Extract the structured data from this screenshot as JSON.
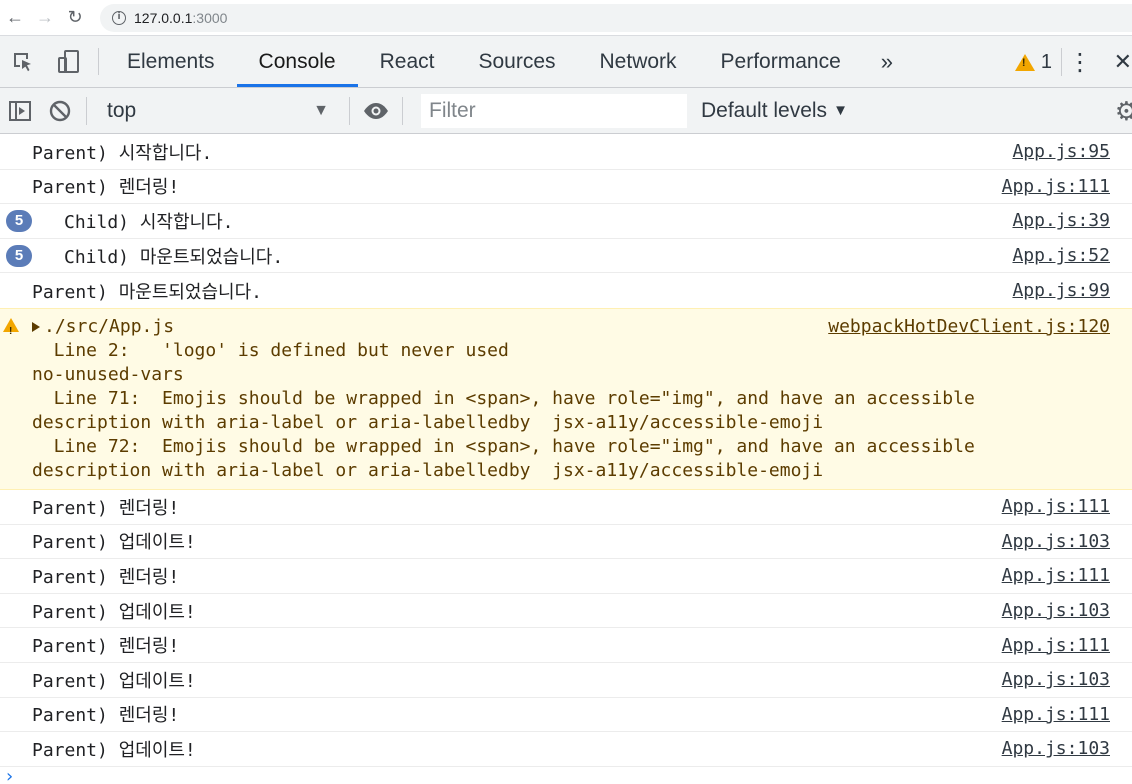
{
  "browser": {
    "url_host": "127.0.0.1",
    "url_port": ":3000"
  },
  "devtools": {
    "tabs": [
      "Elements",
      "Console",
      "React",
      "Sources",
      "Network",
      "Performance"
    ],
    "active_tab": "Console",
    "more_tabs_label": "»",
    "warning_count": "1"
  },
  "console_toolbar": {
    "context": "top",
    "filter_placeholder": "Filter",
    "levels_label": "Default levels"
  },
  "log_rows_top": [
    {
      "message": "Parent) 시작합니다.",
      "source": "App.js:95"
    },
    {
      "message": "Parent) 렌더링!",
      "source": "App.js:111"
    },
    {
      "message": "Child) 시작합니다.",
      "source": "App.js:39",
      "count": "5"
    },
    {
      "message": "Child) 마운트되었습니다.",
      "source": "App.js:52",
      "count": "5"
    },
    {
      "message": "Parent) 마운트되었습니다.",
      "source": "App.js:99"
    }
  ],
  "warning": {
    "file": "./src/App.js",
    "source": "webpackHotDevClient.js:120",
    "body": "  Line 2:   'logo' is defined but never used\nno-unused-vars\n  Line 71:  Emojis should be wrapped in <span>, have role=\"img\", and have an accessible\ndescription with aria-label or aria-labelledby  jsx-a11y/accessible-emoji\n  Line 72:  Emojis should be wrapped in <span>, have role=\"img\", and have an accessible\ndescription with aria-label or aria-labelledby  jsx-a11y/accessible-emoji"
  },
  "log_rows_bottom": [
    {
      "message": "Parent) 렌더링!",
      "source": "App.js:111"
    },
    {
      "message": "Parent) 업데이트!",
      "source": "App.js:103"
    },
    {
      "message": "Parent) 렌더링!",
      "source": "App.js:111"
    },
    {
      "message": "Parent) 업데이트!",
      "source": "App.js:103"
    },
    {
      "message": "Parent) 렌더링!",
      "source": "App.js:111"
    },
    {
      "message": "Parent) 업데이트!",
      "source": "App.js:103"
    },
    {
      "message": "Parent) 렌더링!",
      "source": "App.js:111"
    },
    {
      "message": "Parent) 업데이트!",
      "source": "App.js:103"
    }
  ],
  "colors": {
    "accent": "#1a73e8",
    "warning_bg": "#fffbe5",
    "warning_icon": "#f2a600",
    "count_badge": "#5b7cb8"
  }
}
